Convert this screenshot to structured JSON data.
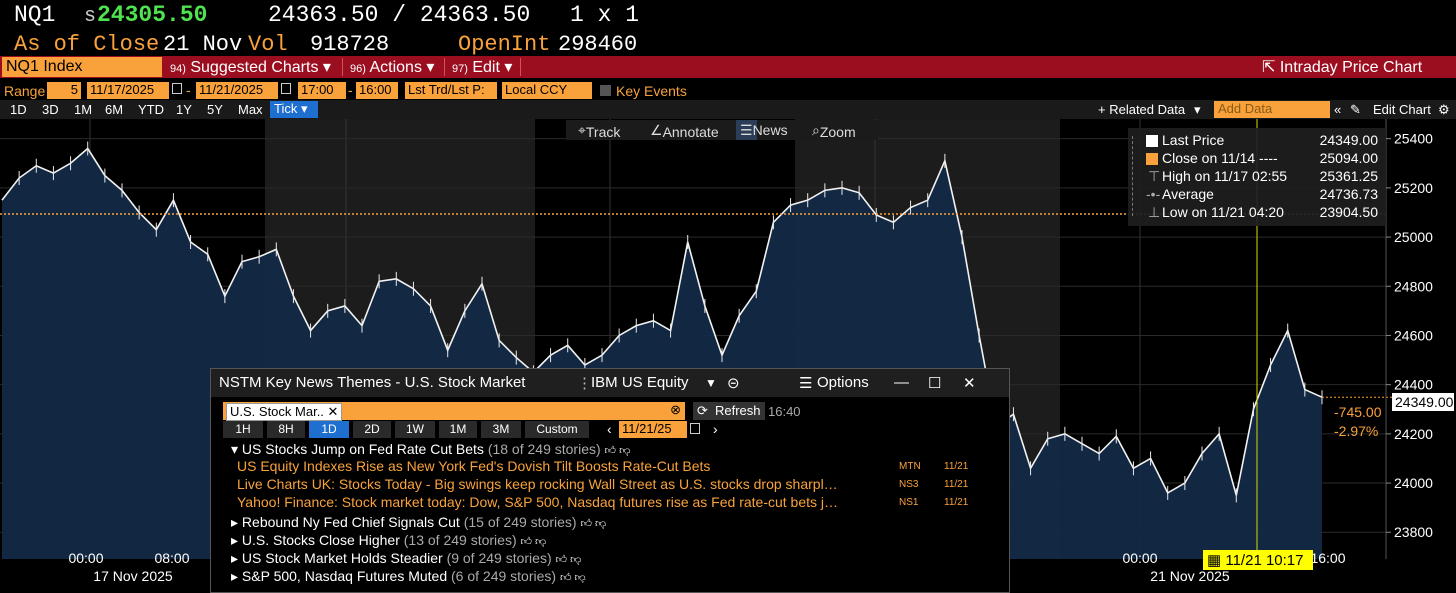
{
  "header": {
    "ticker": "NQ1",
    "price_prefix": "s",
    "price": "24305.50",
    "bid_ask": "24363.50 / 24363.50",
    "size": "1 x 1",
    "as_of": "As of Close",
    "date": "21 Nov",
    "vol_label": "Vol",
    "vol": "918728",
    "openint_label": "OpenInt",
    "openint": "298460"
  },
  "menubar": {
    "security": "NQ1 Index",
    "items": [
      {
        "num": "94)",
        "label": "Suggested Charts"
      },
      {
        "num": "96)",
        "label": "Actions"
      },
      {
        "num": "97)",
        "label": "Edit"
      }
    ],
    "right": "Intraday Price Chart"
  },
  "rangebar": {
    "range_label": "Range",
    "range_value": "5",
    "start": "11/17/2025",
    "end": "11/21/2025",
    "time_start": "17:00",
    "time_end": "16:00",
    "field": "Lst Trd/Lst P:",
    "ccy": "Local CCY",
    "key_events": "Key Events"
  },
  "periods": [
    "1D",
    "3D",
    "1M",
    "6M",
    "YTD",
    "1Y",
    "5Y",
    "Max"
  ],
  "tick": "Tick",
  "tools_right": {
    "related": "+ Related Data",
    "add_data": "Add Data",
    "edit_chart": "Edit Chart"
  },
  "chart_tools": [
    "Track",
    "Annotate",
    "News",
    "Zoom"
  ],
  "legend": [
    {
      "label": "Last Price",
      "value": "24349.00",
      "color": "#ffffff"
    },
    {
      "label": "Close on 11/14 ----",
      "value": "25094.00",
      "color": "#f9a23c"
    },
    {
      "label": "High on 11/17 02:55",
      "value": "25361.25",
      "color": ""
    },
    {
      "label": "Average",
      "value": "24736.73",
      "color": ""
    },
    {
      "label": "Low on 11/21 04:20",
      "value": "23904.50",
      "color": ""
    }
  ],
  "price_tag": "24349.00",
  "change_abs": "-745.00",
  "change_pct": "-2.97%",
  "time_tag": "11/21 10:17",
  "chart_data": {
    "type": "area",
    "title": "",
    "y_ticks": [
      23800,
      24000,
      24200,
      24400,
      24600,
      24800,
      25000,
      25200,
      25400
    ],
    "ylim": [
      23740,
      25480
    ],
    "reference_close": 25094,
    "x_tick_labels": [
      "00:00",
      "08:00",
      "00:00",
      "16:00"
    ],
    "x_day_labels": [
      "17 Nov 2025",
      "21 Nov 2025"
    ],
    "series": [
      {
        "name": "Last Price",
        "values": [
          25150,
          25240,
          25290,
          25260,
          25300,
          25360,
          25250,
          25190,
          25100,
          25030,
          25150,
          24980,
          24930,
          24760,
          24900,
          24920,
          24950,
          24760,
          24620,
          24700,
          24720,
          24640,
          24820,
          24830,
          24790,
          24720,
          24540,
          24700,
          24810,
          24580,
          24510,
          24450,
          24520,
          24560,
          24480,
          24520,
          24600,
          24640,
          24660,
          24620,
          24980,
          24720,
          24520,
          24680,
          24780,
          25060,
          25130,
          25150,
          25190,
          25200,
          25180,
          25090,
          25060,
          25120,
          25150,
          25310,
          25000,
          24600,
          24230,
          24280,
          24060,
          24180,
          24200,
          24160,
          24120,
          24190,
          24060,
          24100,
          23960,
          24000,
          24120,
          24200,
          23950,
          24300,
          24480,
          24620,
          24380,
          24349
        ]
      }
    ]
  },
  "news": {
    "title": "NSTM Key News Themes - U.S. Stock Market",
    "security": "IBM US Equity",
    "options": "Options",
    "search_value": "U.S. Stock Mar..",
    "refresh": "Refresh",
    "refresh_time": "16:40",
    "pills": [
      "1H",
      "8H",
      "1D",
      "2D",
      "1W",
      "1M",
      "3M",
      "Custom"
    ],
    "date": "11/21/25",
    "themes": [
      {
        "label": "US Stocks Jump on Fed Rate Cut Bets",
        "count": "(18 of 249 stories)"
      },
      {
        "label": "Rebound Ny Fed Chief Signals Cut",
        "count": "(15 of 249 stories)"
      },
      {
        "label": "U.S. Stocks Close Higher",
        "count": "(13 of 249 stories)"
      },
      {
        "label": "US Stock Market Holds Steadier",
        "count": "(9 of 249 stories)"
      },
      {
        "label": "S&P 500, Nasdaq Futures Muted",
        "count": "(6 of 249 stories)"
      }
    ],
    "stories": [
      {
        "headline": "US Equity Indexes Rise as New York Fed's Dovish Tilt Boosts Rate-Cut Bets",
        "src": "MTN",
        "date": "11/21"
      },
      {
        "headline": "Live Charts UK: Stocks Today - Big swings keep rocking Wall Street as U.S. stocks drop sharpl…",
        "src": "NS3",
        "date": "11/21"
      },
      {
        "headline": "Yahoo! Finance: Stock market today: Dow, S&P 500, Nasdaq futures rise as Fed rate-cut bets j…",
        "src": "NS1",
        "date": "11/21"
      }
    ]
  }
}
